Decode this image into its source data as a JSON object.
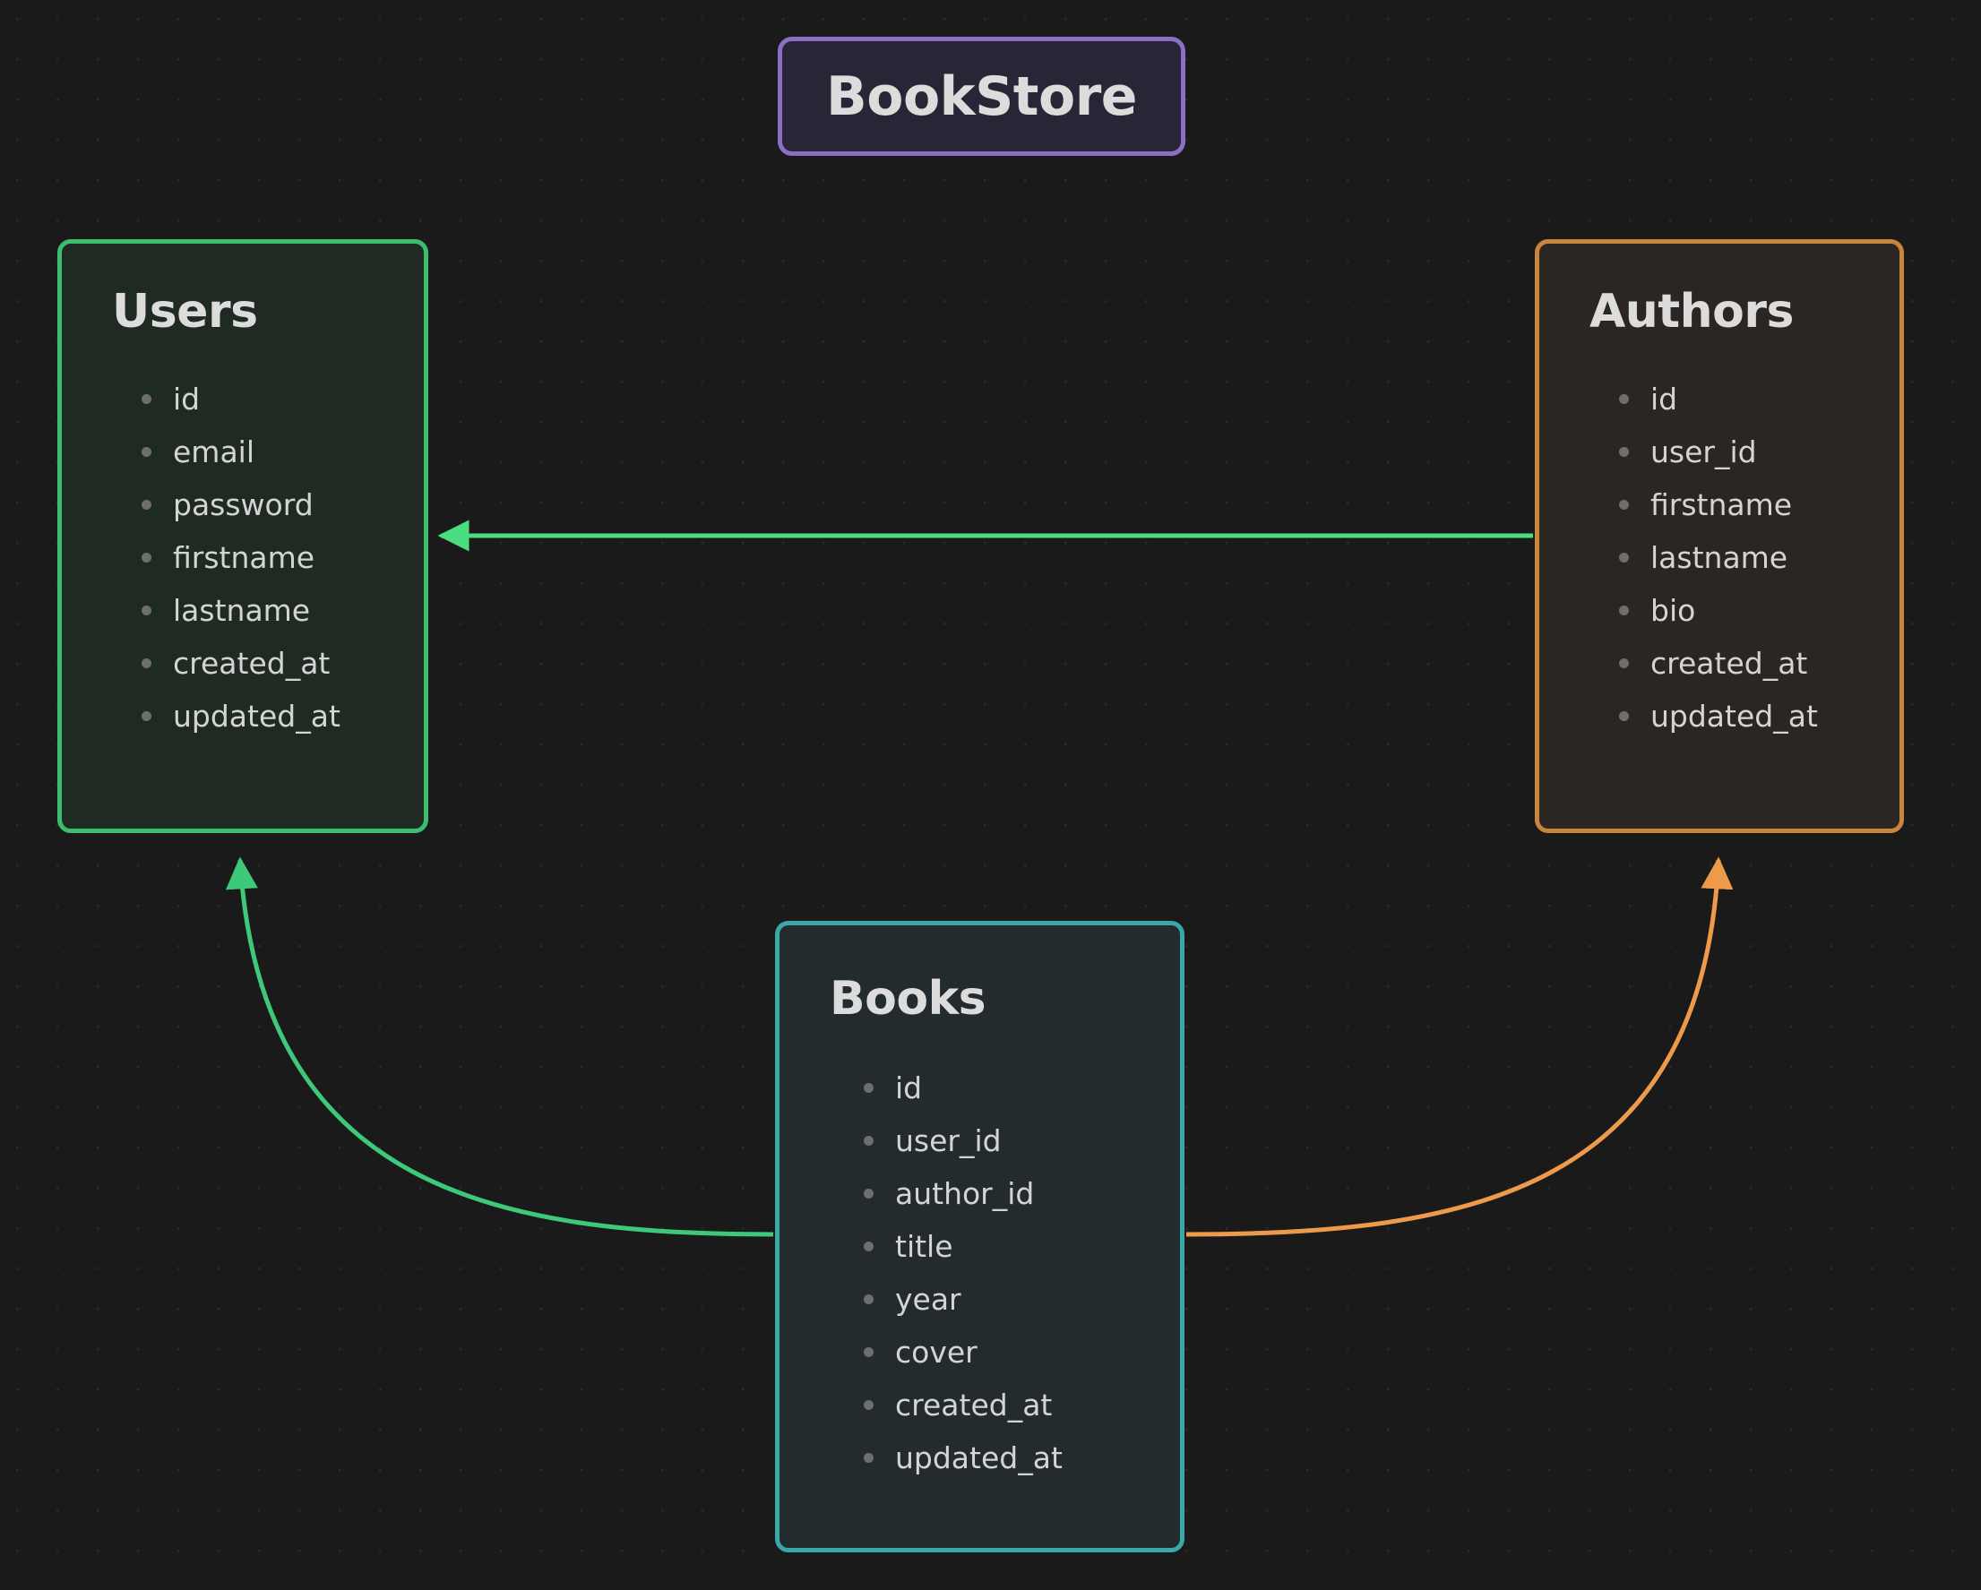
{
  "diagram": {
    "title": "BookStore",
    "background_color": "#1a1a1a",
    "title_border_color": "#8b6fc4",
    "title_fill_color": "#2a2536"
  },
  "entities": {
    "users": {
      "name": "Users",
      "border_color": "#3dbd6e",
      "fill_color": "#1f2a22",
      "fields": [
        "id",
        "email",
        "password",
        "firstname",
        "lastname",
        "created_at",
        "updated_at"
      ]
    },
    "authors": {
      "name": "Authors",
      "border_color": "#c8863c",
      "fill_color": "#2b2621",
      "fields": [
        "id",
        "user_id",
        "firstname",
        "lastname",
        "bio",
        "created_at",
        "updated_at"
      ]
    },
    "books": {
      "name": "Books",
      "border_color": "#3aa8a8",
      "fill_color": "#232b2e",
      "fields": [
        "id",
        "user_id",
        "author_id",
        "title",
        "year",
        "cover",
        "created_at",
        "updated_at"
      ]
    }
  },
  "relationships": [
    {
      "id": "authors-to-users",
      "from": "Authors",
      "to": "Users",
      "color": "#4ade80",
      "style": "straight"
    },
    {
      "id": "books-to-users",
      "from": "Books",
      "to": "Users",
      "color": "#3ec97a",
      "style": "curved"
    },
    {
      "id": "books-to-authors",
      "from": "Books",
      "to": "Authors",
      "color": "#ed9a4a",
      "style": "curved"
    }
  ]
}
